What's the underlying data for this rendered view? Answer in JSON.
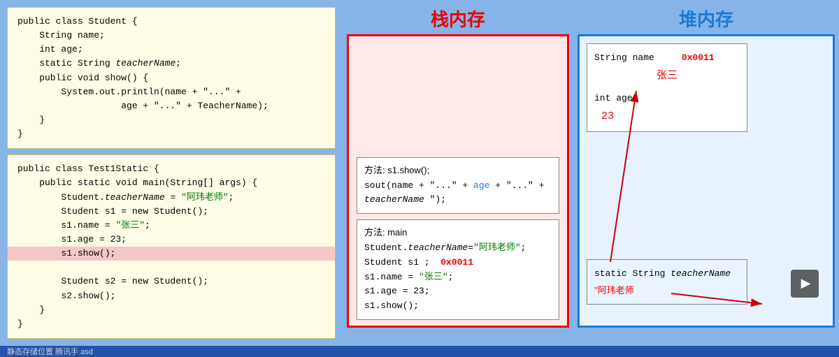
{
  "titles": {
    "stack": "栈内存",
    "heap": "堆内存"
  },
  "code_box1": {
    "lines": [
      "public class Student {",
      "    String name;",
      "    int age;",
      "    static String teacherName;",
      "    public void show() {",
      "        System.out.println(name + \"...\" +",
      "                           age + \"...\" + TeacherName);",
      "    }",
      "}"
    ]
  },
  "code_box2": {
    "lines": [
      "public class Test1Static {",
      "    public static void main(String[] args) {",
      "        Student.teacherName = \"阿玮老师\";",
      "        Student s1 = new Student();",
      "        s1.name = \"张三\";",
      "        s1.age = 23;",
      "        s1.show();",
      "",
      "        Student s2 = new Student();",
      "        s2.show();",
      "    }",
      "}"
    ],
    "highlight_line": 6
  },
  "stack_frame_show": {
    "title": "方法: s1.show();",
    "lines": [
      "sout(name + \"...\" + age + \"...\" +",
      "teacherName \");"
    ]
  },
  "stack_frame_main": {
    "title": "方法: main",
    "line1": "Student.teacherName=\"阿玮老师\";",
    "line2_prefix": "Student s1 ;",
    "line2_addr": "0x0011",
    "line3": "s1.name = \"张三\";",
    "line4": "s1.age = 23;",
    "line5": "s1.show();"
  },
  "heap_object": {
    "field1": "String name",
    "addr": "0x0011",
    "value1": "张三",
    "field2": "int age",
    "value2": "23"
  },
  "heap_static": {
    "label": "static String teacherName",
    "value": "\"阿玮老师"
  },
  "bottom_bar": {
    "text": "静态存储位置 腾讯手 asd"
  },
  "play_button_label": "▶"
}
